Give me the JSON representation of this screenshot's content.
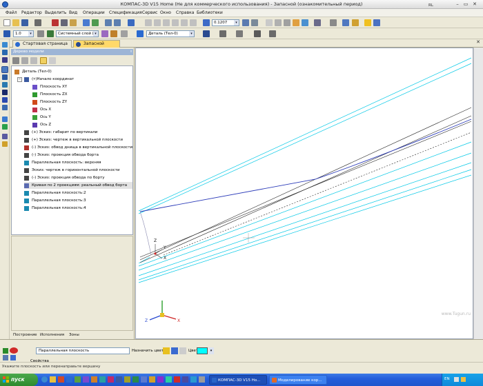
{
  "window": {
    "title": "КОМПАС-3D V15 Home (Не для коммерческого использования) - Запасной (ознакомительный период)"
  },
  "menu": [
    "Файл",
    "Редактор",
    "Выделить",
    "Вид",
    "Операции",
    "Спецификация",
    "Сервис",
    "Окно",
    "Справка",
    "Библиотеки"
  ],
  "toolbar": {
    "zoom_value": "0.1207",
    "line_width": "1.0",
    "layer": "Системный слой (0)",
    "part": "Деталь (Тел-0)"
  },
  "tabs": [
    {
      "label": "Стартовая страница",
      "active": false
    },
    {
      "label": "Запасной",
      "active": true
    }
  ],
  "tree_panel": {
    "title": "Дерево модели",
    "pin": "ᵡ",
    "nodes": [
      {
        "label": "Деталь (Тел-0)",
        "icon": "part-icon",
        "color": "#c97a2a"
      },
      {
        "label": "(т)Начало координат",
        "icon": "origin-icon",
        "color": "#3b5aa0"
      },
      {
        "label": "Плоскость XY",
        "icon": "plane-xy-icon",
        "color": "#6b4fc9"
      },
      {
        "label": "Плоскость ZX",
        "icon": "plane-zx-icon",
        "color": "#2f9a2f"
      },
      {
        "label": "Плоскость ZY",
        "icon": "plane-zy-icon",
        "color": "#d04a1a"
      },
      {
        "label": "Ось X",
        "icon": "axis-x-icon",
        "color": "#c0304a"
      },
      {
        "label": "Ось Y",
        "icon": "axis-y-icon",
        "color": "#3aa03a"
      },
      {
        "label": "Ось Z",
        "icon": "axis-z-icon",
        "color": "#5a3ab0"
      },
      {
        "label": "(+) Эскиз: габарит по вертикали",
        "icon": "sketch-icon",
        "color": "#444"
      },
      {
        "label": "(+) Эскиз: чертеж в вертикальной плоскости",
        "icon": "sketch-icon",
        "color": "#444"
      },
      {
        "label": "(-) Эскиз: обвод днища в вертикальной плоскости",
        "icon": "sketch-error-icon",
        "color": "#b0302a"
      },
      {
        "label": "(-) Эскиз: проекция обвода борта",
        "icon": "sketch-icon",
        "color": "#444"
      },
      {
        "label": "Параллельная плоскость: верхняя",
        "icon": "parallel-plane-icon",
        "color": "#1a8ab0"
      },
      {
        "label": "Эскиз: чертеж в горизонтальной плоскости",
        "icon": "sketch-icon",
        "color": "#444"
      },
      {
        "label": "(-) Эскиз: проекция обвода по борту",
        "icon": "sketch-icon",
        "color": "#444"
      },
      {
        "label": "Кривая по 2 проекциям: реальный обвод борта",
        "icon": "curve-icon",
        "color": "#5a6ab0"
      },
      {
        "label": "Параллельная плоскость:2",
        "icon": "parallel-plane-icon",
        "color": "#1a8ab0"
      },
      {
        "label": "Параллельная плоскость:3",
        "icon": "parallel-plane-icon",
        "color": "#1a8ab0"
      },
      {
        "label": "Параллельная плоскость:4",
        "icon": "parallel-plane-icon",
        "color": "#1a8ab0"
      }
    ],
    "bottom_tabs": [
      "Построение",
      "Исполнения",
      "Зоны"
    ]
  },
  "viewport": {
    "axes": [
      "Z",
      "Y",
      "X"
    ],
    "watermark": "www.Tugun.ru"
  },
  "properties": {
    "field_value": "Параллельная плоскость",
    "assign_color_label": "Назначить цвет",
    "color_label": "Цвет",
    "color_value": "#00ffff",
    "tab_label": "Свойства"
  },
  "status": {
    "hint": "Укажите плоскость или перенаправьте вершину",
    "layout": "RL"
  },
  "taskbar": {
    "start": "пуск",
    "tasks": [
      "КОМПАС-3D V15 Ho...",
      "Моделирование кор..."
    ],
    "lang": "EN",
    "clock": ""
  }
}
